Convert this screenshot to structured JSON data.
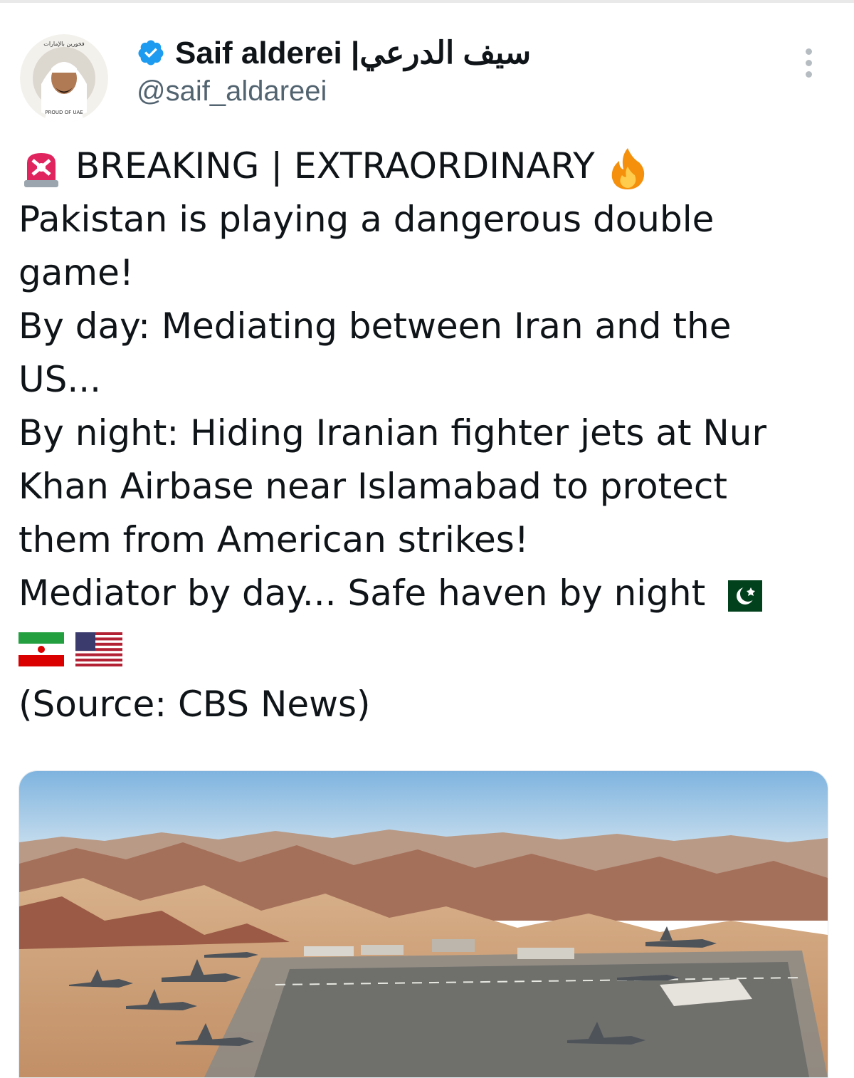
{
  "tweet": {
    "author": {
      "display_name": "Saif alderei |سيف الدرعي",
      "handle": "@saif_aldareei",
      "verified": true,
      "avatar_badge_top": "فخورين بالإمارات",
      "avatar_badge_bottom": "PROUD OF UAE"
    },
    "lines": [
      "BREAKING | EXTRAORDINARY",
      "Pakistan is playing a dangerous double",
      "game!",
      "By day: Mediating between Iran and the",
      "US...",
      "By night: Hiding Iranian fighter jets at Nur",
      "Khan Airbase near Islamabad to protect",
      "them from American strikes!",
      "Mediator by day... Safe haven by night"
    ],
    "source": "(Source: CBS News)",
    "emojis": [
      "rotating-light-icon",
      "fire-icon",
      "pakistan-flag-icon",
      "iran-flag-icon",
      "us-flag-icon"
    ],
    "media": {
      "description_icon": "airbase-photo"
    }
  },
  "colors": {
    "verified_blue": "#1d9bf0",
    "text": "#0f1419",
    "secondary": "#536471"
  }
}
